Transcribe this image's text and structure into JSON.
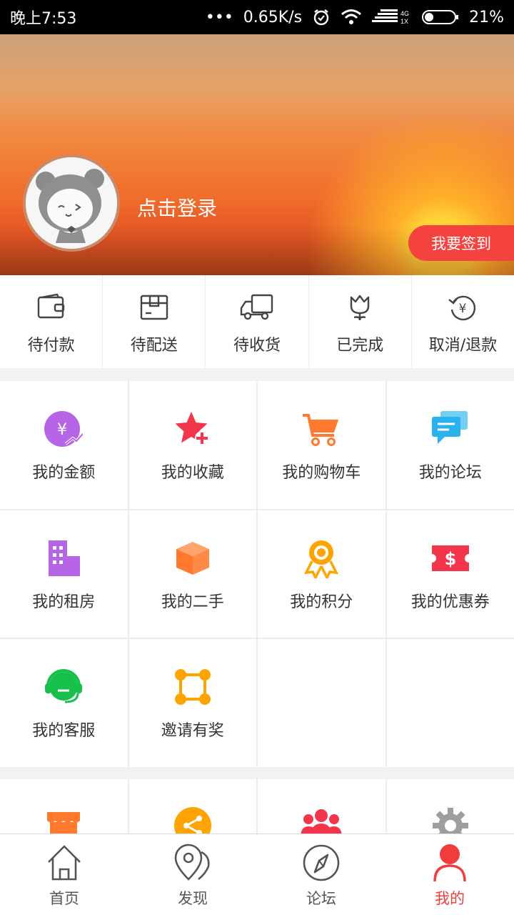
{
  "status_bar": {
    "time": "晚上7:53",
    "speed": "0.65K/s",
    "network": "4G",
    "sim": "1X",
    "battery": "21%"
  },
  "profile": {
    "login_text": "点击登录",
    "signin_label": "我要签到"
  },
  "orders": [
    {
      "label": "待付款",
      "icon": "wallet-icon"
    },
    {
      "label": "待配送",
      "icon": "package-icon"
    },
    {
      "label": "待收货",
      "icon": "truck-icon"
    },
    {
      "label": "已完成",
      "icon": "tulip-icon"
    },
    {
      "label": "取消/退款",
      "icon": "refund-icon"
    }
  ],
  "features": [
    {
      "label": "我的金额",
      "icon": "balance-icon",
      "color": "#b565e6"
    },
    {
      "label": "我的收藏",
      "icon": "favorite-star-icon",
      "color": "#f4364c"
    },
    {
      "label": "我的购物车",
      "icon": "cart-icon",
      "color": "#ff7a2e"
    },
    {
      "label": "我的论坛",
      "icon": "chat-bubbles-icon",
      "color": "#2ab2ee"
    },
    {
      "label": "我的租房",
      "icon": "building-icon",
      "color": "#b565e6"
    },
    {
      "label": "我的二手",
      "icon": "box-icon",
      "color": "#ff7a2e"
    },
    {
      "label": "我的积分",
      "icon": "medal-icon",
      "color": "#ffa300"
    },
    {
      "label": "我的优惠券",
      "icon": "coupon-icon",
      "color": "#f4364c"
    },
    {
      "label": "我的客服",
      "icon": "headset-icon",
      "color": "#17c04b"
    },
    {
      "label": "邀请有奖",
      "icon": "invite-network-icon",
      "color": "#ffa300"
    }
  ],
  "more_icons": [
    {
      "icon": "shop-icon",
      "color": "#ff7a2e"
    },
    {
      "icon": "share-icon",
      "color": "#ffa300"
    },
    {
      "icon": "group-icon",
      "color": "#f4364c"
    },
    {
      "icon": "settings-gear-icon",
      "color": "#9e9e9e"
    }
  ],
  "tabs": [
    {
      "label": "首页",
      "icon": "home-icon"
    },
    {
      "label": "发现",
      "icon": "map-pin-icon"
    },
    {
      "label": "论坛",
      "icon": "compass-icon"
    },
    {
      "label": "我的",
      "icon": "user-icon",
      "active": true
    }
  ]
}
